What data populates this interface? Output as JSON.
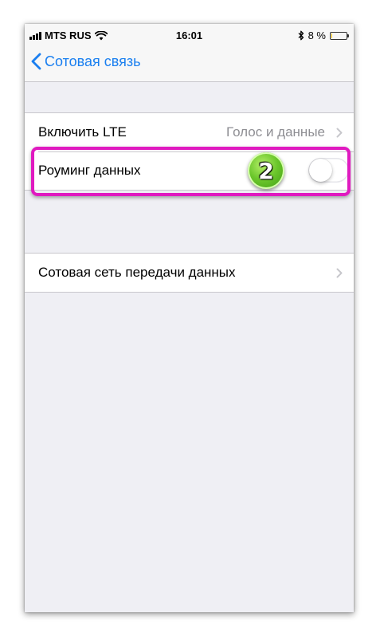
{
  "status_bar": {
    "carrier": "MTS RUS",
    "time": "16:01",
    "battery": "8 %",
    "battery_level": 0.08
  },
  "nav": {
    "back_label": "Сотовая связь"
  },
  "settings": {
    "lte": {
      "label": "Включить LTE",
      "value": "Голос и данные"
    },
    "roaming": {
      "label": "Роуминг данных",
      "enabled": false
    },
    "cellular_network": {
      "label": "Сотовая сеть передачи данных"
    }
  },
  "annotation": {
    "step_number": "2",
    "highlight_color": "#e01ac0",
    "badge_color": "#6cc72c"
  },
  "colors": {
    "accent": "#1a7ff0",
    "background": "#efeff4",
    "secondary_text": "#8e8e93"
  }
}
